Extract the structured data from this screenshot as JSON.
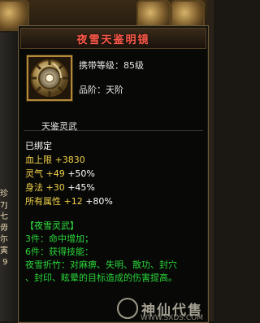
{
  "background": {
    "side_list": [
      "珍",
      "7J",
      "七",
      "毋",
      "尓",
      "寅",
      " 9"
    ]
  },
  "tooltip": {
    "title": "夜雪天鉴明镜",
    "carry_level": "携带等级：85级",
    "rank": "品阶：天阶",
    "item_type": "天鉴灵武",
    "bound": "已绑定",
    "stats": [
      {
        "name": "血上限",
        "value": "+3830",
        "pct": ""
      },
      {
        "name": "灵气",
        "value": "+49",
        "pct": "+50%"
      },
      {
        "name": "身法",
        "value": "+30",
        "pct": "+45%"
      },
      {
        "name": "所有属性",
        "value": "+12",
        "pct": "+80%"
      }
    ],
    "set": {
      "title": "【夜雪灵武】",
      "line1": "3件：命中增加；",
      "line2": "6件：获得技能：",
      "line3": "夜雪折竹：对麻痹、失明、散功、封穴",
      "line4": "、封印、眩晕的目标造成的伤害提高。"
    }
  },
  "watermark": {
    "brand": "神仙代售",
    "site": "WWW.SXDS.COM"
  },
  "colors": {
    "title": "#ff5a4a",
    "stat_gold": "#f2d24a",
    "set_green": "#29d63a",
    "frame_gold": "#b48a3a"
  }
}
